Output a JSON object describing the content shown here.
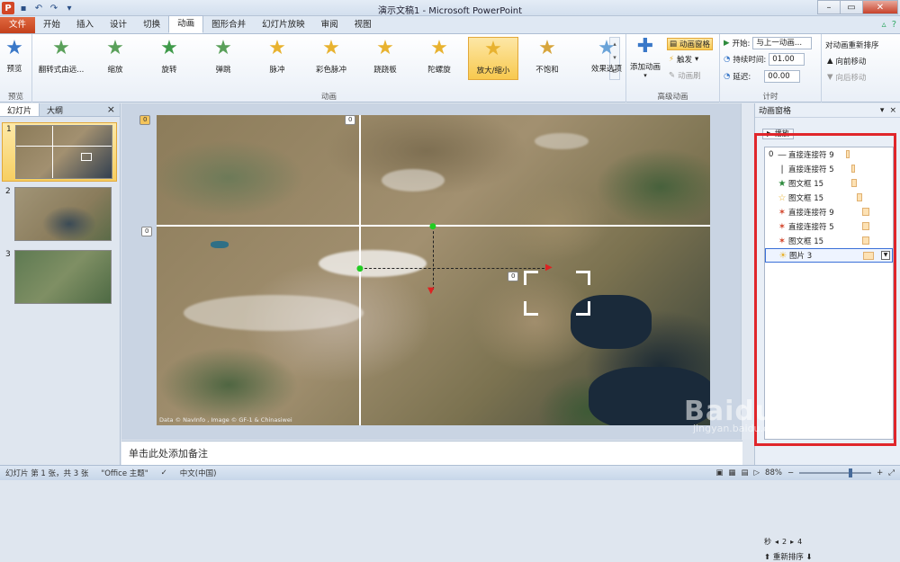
{
  "window": {
    "title": "演示文稿1 - Microsoft PowerPoint"
  },
  "qat": {
    "app_icon": "P"
  },
  "tabs": [
    "文件",
    "开始",
    "插入",
    "设计",
    "切换",
    "动画",
    "图形合并",
    "幻灯片放映",
    "审阅",
    "视图"
  ],
  "ribbon": {
    "preview": {
      "label": "预览",
      "group": "预览"
    },
    "animations": [
      {
        "label": "翻转式由远...",
        "color": "#5aa05a"
      },
      {
        "label": "缩放",
        "color": "#5aa05a"
      },
      {
        "label": "旋转",
        "color": "#3f9a4a"
      },
      {
        "label": "弹跳",
        "color": "#5aa05a"
      },
      {
        "label": "脉冲",
        "color": "#e8b22f"
      },
      {
        "label": "彩色脉冲",
        "color": "#e8b22f"
      },
      {
        "label": "跷跷板",
        "color": "#e8b22f"
      },
      {
        "label": "陀螺旋",
        "color": "#e8b22f"
      },
      {
        "label": "放大/缩小",
        "color": "#e8b22f"
      },
      {
        "label": "不饱和",
        "color": "#d7a53c"
      }
    ],
    "animation_group": "动画",
    "effect_options": "效果选项",
    "add_animation": "添加动画",
    "anim_pane_btn": "动画窗格",
    "trigger": "触发",
    "anim_painter": "动画刷",
    "advanced_group": "高级动画",
    "start_label": "开始:",
    "start_value": "与上一动画...",
    "duration_label": "持续时间:",
    "duration_value": "01.00",
    "delay_label": "延迟:",
    "delay_value": "00.00",
    "timing_group": "计时",
    "reorder_title": "对动画重新排序",
    "move_earlier": "向前移动",
    "move_later": "向后移动"
  },
  "leftpane": {
    "tab_slides": "幻灯片",
    "tab_outline": "大纲",
    "slides": [
      "1",
      "2",
      "3"
    ]
  },
  "slide": {
    "credit": "Data © NavInfo , Image © GF-1 & Chinasiwei",
    "guide_marks": [
      "0",
      "0",
      "0",
      "0"
    ]
  },
  "notes": {
    "placeholder": "单击此处添加备注"
  },
  "animpane": {
    "title": "动画窗格",
    "play": "▶ 播放",
    "items": [
      {
        "idx": "0",
        "icon": "—",
        "name": "直接连接符 9"
      },
      {
        "idx": "",
        "icon": "|",
        "name": "直接连接符 5"
      },
      {
        "idx": "",
        "icon": "★",
        "name": "图文框 15"
      },
      {
        "idx": "",
        "icon": "☆",
        "name": "图文框 15"
      },
      {
        "idx": "",
        "icon": "✶",
        "name": "直接连接符 9"
      },
      {
        "idx": "",
        "icon": "✶",
        "name": "直接连接符 5"
      },
      {
        "idx": "",
        "icon": "✶",
        "name": "图文框 15"
      },
      {
        "idx": "",
        "icon": "☀",
        "name": "图片 3"
      }
    ],
    "seconds": "秒",
    "page_a": "2",
    "page_b": "4",
    "reorder": "重新排序"
  },
  "status": {
    "slide_info": "幻灯片 第 1 张，共 3 张",
    "theme": "\"Office 主题\"",
    "lang": "中文(中国)",
    "zoom": "88%"
  },
  "watermark": {
    "main": "Baidu 经验",
    "sub": "jingyan.baidu.com"
  }
}
